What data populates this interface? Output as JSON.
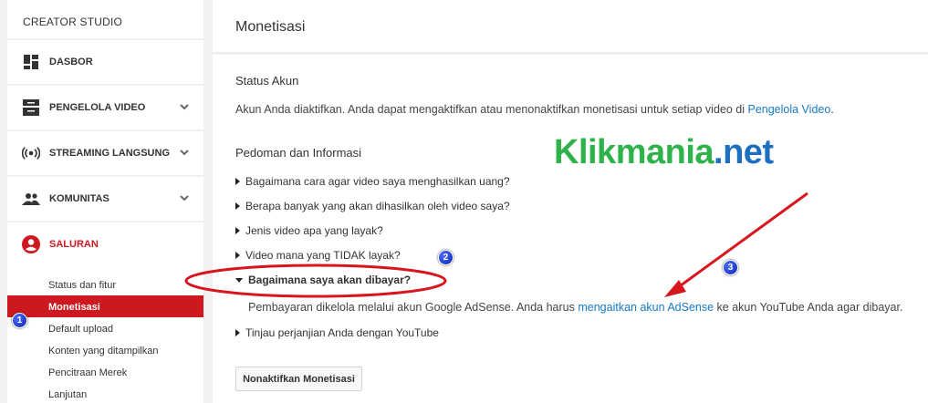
{
  "sidebar": {
    "title": "CREATOR STUDIO",
    "nav": [
      {
        "label": "DASBOR",
        "icon": "dashboard-icon"
      },
      {
        "label": "PENGELOLA VIDEO",
        "icon": "video-manager-icon"
      },
      {
        "label": "STREAMING LANGSUNG",
        "icon": "live-streaming-icon"
      },
      {
        "label": "KOMUNITAS",
        "icon": "community-icon"
      },
      {
        "label": "SALURAN",
        "icon": "channel-icon"
      }
    ],
    "sub_items": [
      "Status dan fitur",
      "Monetisasi",
      "Default upload",
      "Konten yang ditampilkan",
      "Pencitraan Merek",
      "Lanjutan"
    ]
  },
  "main": {
    "title": "Monetisasi",
    "status": {
      "heading": "Status Akun",
      "text": "Akun Anda diaktifkan. Anda dapat mengaktifkan atau menonaktifkan monetisasi untuk setiap video di ",
      "link": "Pengelola Video",
      "text_end": "."
    },
    "guide": {
      "heading": "Pedoman dan Informasi",
      "items": [
        "Bagaimana cara agar video saya menghasilkan uang?",
        "Berapa banyak yang akan dihasilkan oleh video saya?",
        "Jenis video apa yang layak?",
        "Video mana yang TIDAK layak?",
        "Bagaimana saya akan dibayar?",
        "Tinjau perjanjian Anda dengan YouTube"
      ],
      "answer_before": "Pembayaran dikelola melalui akun Google AdSense. Anda harus ",
      "answer_link": "mengaitkan akun AdSense",
      "answer_after": " ke akun YouTube Anda agar dibayar."
    },
    "disable_button": "Nonaktifkan Monetisasi"
  },
  "watermark": {
    "part1": "Klikmania",
    "part2": ".net"
  },
  "badges": [
    "1",
    "2",
    "3"
  ],
  "colors": {
    "accent": "#cc181e",
    "link": "#167ac6",
    "annotation": "#d8141c"
  }
}
